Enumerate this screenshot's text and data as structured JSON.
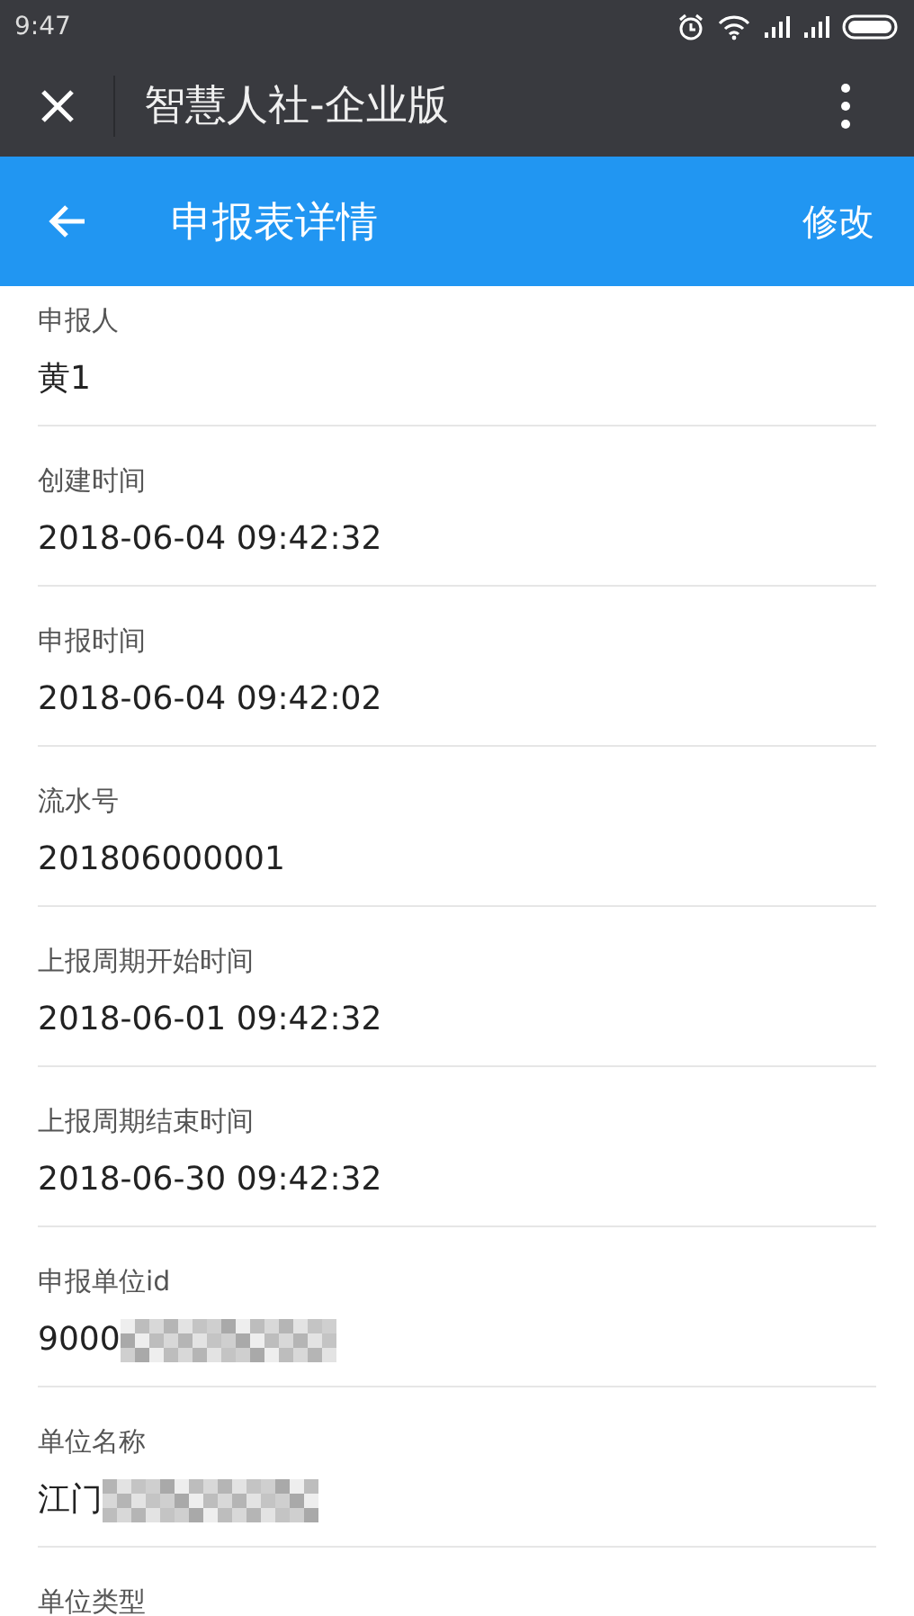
{
  "status_bar": {
    "time": "9:47"
  },
  "app_bar": {
    "title": "智慧人社-企业版"
  },
  "header": {
    "title": "申报表详情",
    "action": "修改"
  },
  "fields": [
    {
      "label": "申报人",
      "value": "黄1",
      "redacted": false
    },
    {
      "label": "创建时间",
      "value": "2018-06-04 09:42:32",
      "redacted": false
    },
    {
      "label": "申报时间",
      "value": "2018-06-04 09:42:02",
      "redacted": false
    },
    {
      "label": "流水号",
      "value": "201806000001",
      "redacted": false
    },
    {
      "label": "上报周期开始时间",
      "value": "2018-06-01 09:42:32",
      "redacted": false
    },
    {
      "label": "上报周期结束时间",
      "value": "2018-06-30 09:42:32",
      "redacted": false
    },
    {
      "label": "申报单位id",
      "value": "9000",
      "redacted": true
    },
    {
      "label": "单位名称",
      "value": "江门",
      "redacted": true
    },
    {
      "label": "单位类型",
      "redacted": false
    }
  ]
}
